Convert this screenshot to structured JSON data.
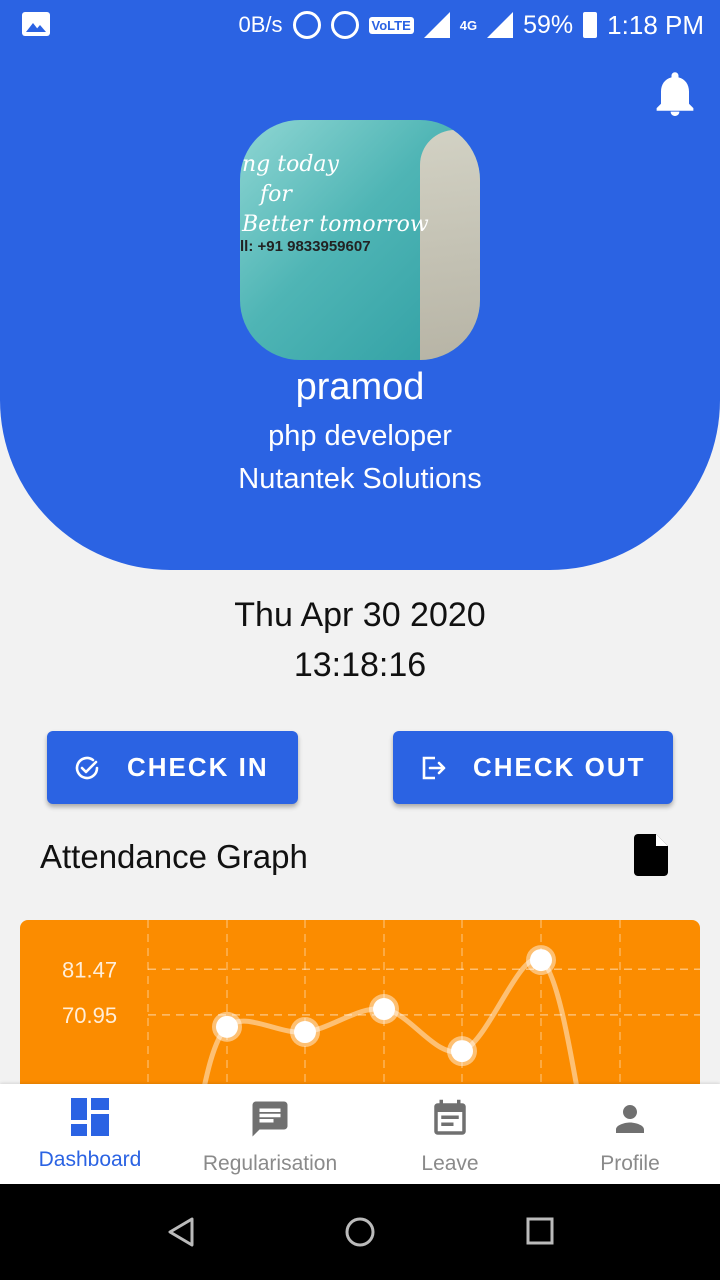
{
  "status_bar": {
    "speed": "0B/s",
    "volte": "VoLTE",
    "network": "4G",
    "battery": "59%",
    "time": "1:18 PM"
  },
  "header": {
    "avatar_text_line1": "ng today",
    "avatar_text_line2": "for",
    "avatar_text_line3": "Better tomorrow",
    "avatar_phone": "ll: +91 9833959607",
    "name": "pramod",
    "role": "php developer",
    "company": "Nutantek Solutions"
  },
  "datetime": {
    "date": "Thu Apr 30 2020",
    "time": "13:18:16"
  },
  "actions": {
    "check_in": "CHECK IN",
    "check_out": "CHECK OUT"
  },
  "attendance": {
    "title": "Attendance Graph"
  },
  "chart_data": {
    "type": "line",
    "y_ticks": [
      "81.47",
      "70.95"
    ],
    "values": [
      68.2,
      67.0,
      72.3,
      62.6,
      83.6
    ],
    "ylim": [
      58,
      85
    ]
  },
  "colors": {
    "primary": "#2b63e3",
    "chart_bg": "#fb8c00",
    "nav_inactive": "#8a8a8a"
  },
  "bottom_nav": {
    "items": [
      {
        "label": "Dashboard",
        "icon": "dashboard-icon",
        "active": true
      },
      {
        "label": "Regularisation",
        "icon": "feedback-icon",
        "active": false
      },
      {
        "label": "Leave",
        "icon": "event-note-icon",
        "active": false
      },
      {
        "label": "Profile",
        "icon": "person-icon",
        "active": false
      }
    ]
  }
}
